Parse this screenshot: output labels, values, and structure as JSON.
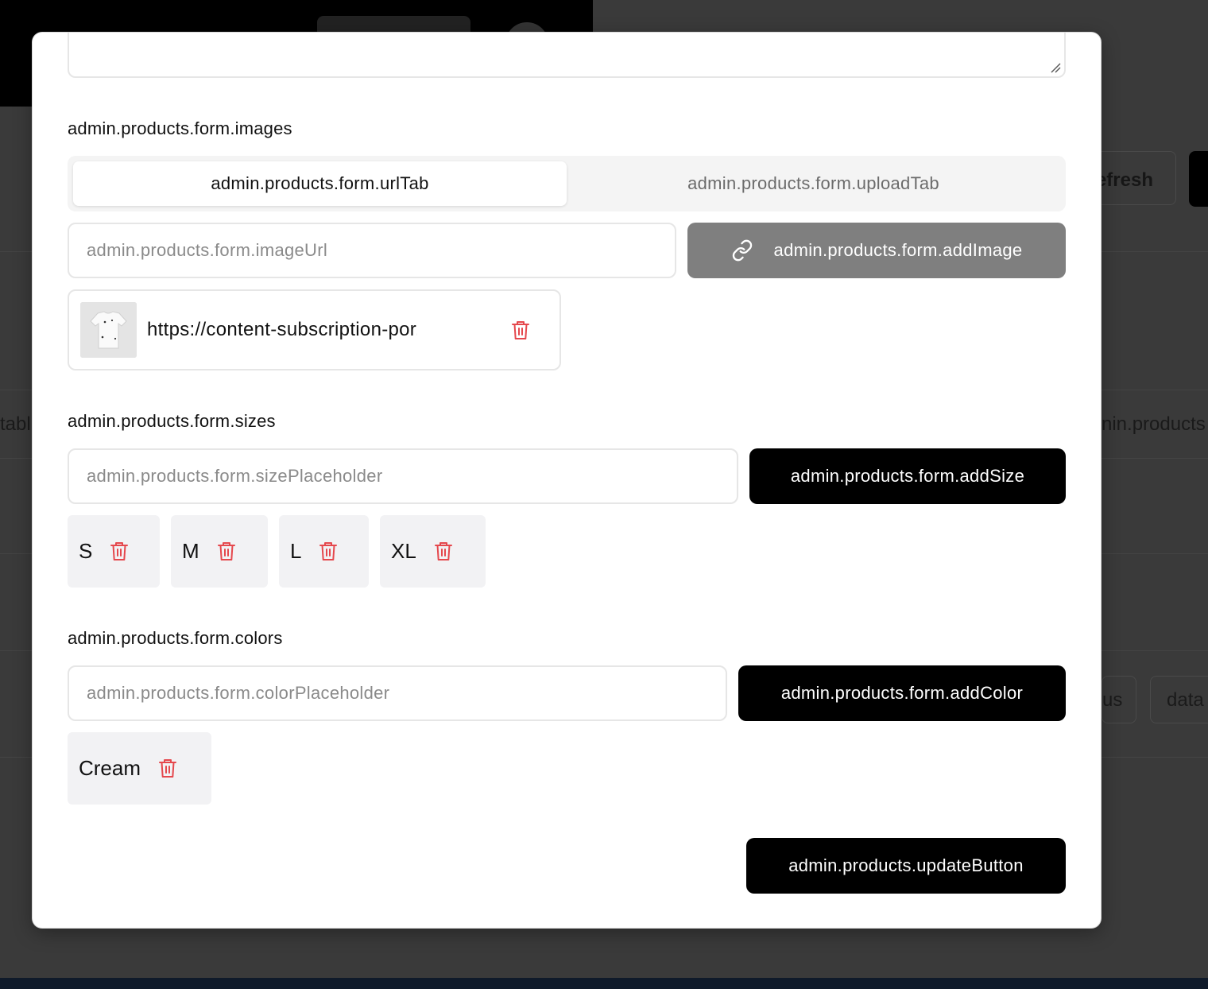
{
  "background": {
    "refresh_label": "efresh",
    "left_fragment": "tabl",
    "right_fragment": "nin.products",
    "status_fragment": "us",
    "data_fragment": "data"
  },
  "modal": {
    "images": {
      "label": "admin.products.form.images",
      "tabs": [
        {
          "label": "admin.products.form.urlTab",
          "active": true
        },
        {
          "label": "admin.products.form.uploadTab",
          "active": false
        }
      ],
      "url_input_placeholder": "admin.products.form.imageUrl",
      "add_image_label": "admin.products.form.addImage",
      "items": [
        {
          "url": "https://content-subscription-por..."
        }
      ]
    },
    "sizes": {
      "label": "admin.products.form.sizes",
      "input_placeholder": "admin.products.form.sizePlaceholder",
      "add_label": "admin.products.form.addSize",
      "items": [
        "S",
        "M",
        "L",
        "XL"
      ]
    },
    "colors": {
      "label": "admin.products.form.colors",
      "input_placeholder": "admin.products.form.colorPlaceholder",
      "add_label": "admin.products.form.addColor",
      "items": [
        "Cream"
      ]
    },
    "update_button_label": "admin.products.updateButton"
  },
  "colors": {
    "danger": "#e5484d",
    "primary": "#000000",
    "disabled_button": "#7f7f7f",
    "overlay": "#3a3a3a"
  },
  "icons": {
    "link": "link-icon",
    "delete": "trash-icon"
  }
}
